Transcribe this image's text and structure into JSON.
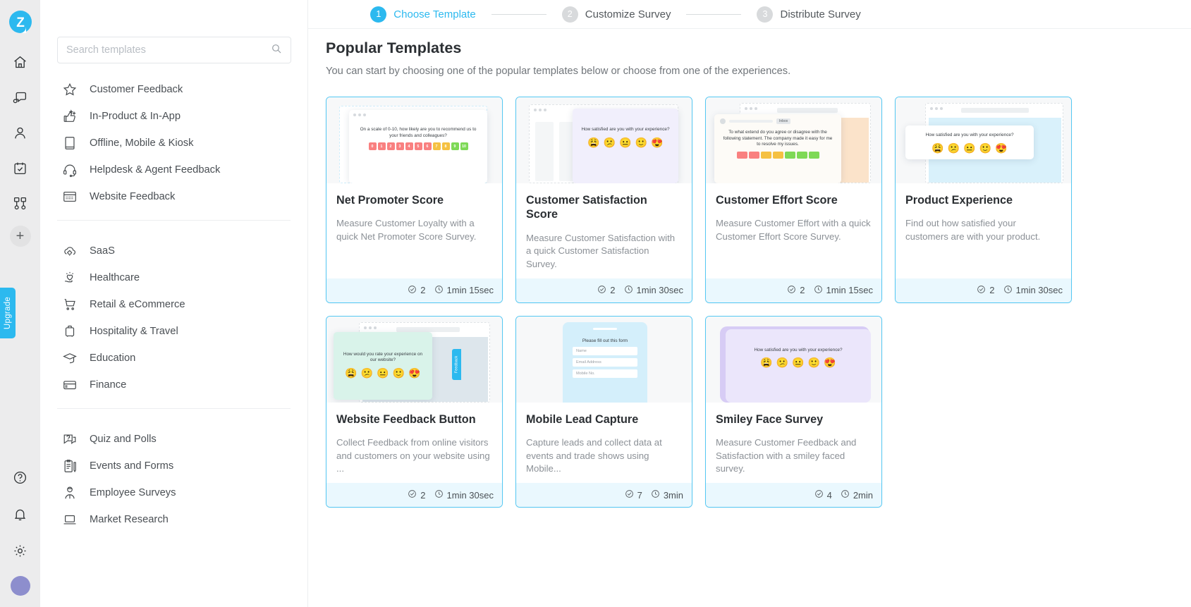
{
  "brand": {
    "logo_text": "Z",
    "accent": "#2cb9ef"
  },
  "rail": {
    "icons": [
      {
        "name": "home-icon"
      },
      {
        "name": "feedback-chat-icon"
      },
      {
        "name": "contacts-user-icon"
      },
      {
        "name": "calendar-check-icon"
      },
      {
        "name": "workflow-icon"
      }
    ],
    "add_label": "+",
    "upgrade_label": "Upgrade",
    "bottom_icons": [
      {
        "name": "help-icon"
      },
      {
        "name": "notifications-bell-icon"
      },
      {
        "name": "settings-gear-icon"
      }
    ]
  },
  "stepper": {
    "steps": [
      {
        "num": "1",
        "label": "Choose Template",
        "active": true
      },
      {
        "num": "2",
        "label": "Customize Survey",
        "active": false
      },
      {
        "num": "3",
        "label": "Distribute Survey",
        "active": false
      }
    ]
  },
  "search": {
    "placeholder": "Search templates",
    "value": ""
  },
  "sidebar": {
    "group1": [
      {
        "label": "Customer Feedback",
        "icon": "star-icon"
      },
      {
        "label": "In-Product & In-App",
        "icon": "thumbs-up-sparkle-icon"
      },
      {
        "label": "Offline, Mobile & Kiosk",
        "icon": "tablet-icon"
      },
      {
        "label": "Helpdesk & Agent Feedback",
        "icon": "headset-icon"
      },
      {
        "label": "Website Feedback",
        "icon": "browser-window-icon"
      }
    ],
    "group2": [
      {
        "label": "SaaS",
        "icon": "cloud-gear-icon"
      },
      {
        "label": "Healthcare",
        "icon": "heart-care-icon"
      },
      {
        "label": "Retail & eCommerce",
        "icon": "shopping-cart-icon"
      },
      {
        "label": "Hospitality & Travel",
        "icon": "suitcase-icon"
      },
      {
        "label": "Education",
        "icon": "graduation-cap-icon"
      },
      {
        "label": "Finance",
        "icon": "wallet-icon"
      }
    ],
    "group3": [
      {
        "label": "Quiz and Polls",
        "icon": "question-chat-icon"
      },
      {
        "label": "Events and Forms",
        "icon": "clipboard-pen-icon"
      },
      {
        "label": "Employee Surveys",
        "icon": "employee-icon"
      },
      {
        "label": "Market Research",
        "icon": "laptop-icon"
      }
    ]
  },
  "main": {
    "title": "Popular Templates",
    "subtitle": "You can start by choosing one of the popular templates below or choose from one of the experiences."
  },
  "templates": [
    {
      "title": "Net Promoter Score",
      "desc": "Measure Customer Loyalty with a quick Net Promoter Score Survey.",
      "questions": "2",
      "duration": "1min 15sec",
      "preview": {
        "kind": "nps",
        "question": "On a scale of 0-10, how likely are you to recommend us to your friends and colleagues?",
        "scale": [
          "0",
          "1",
          "2",
          "3",
          "4",
          "5",
          "6",
          "7",
          "8",
          "9",
          "10"
        ],
        "scale_colors": [
          "#f98080",
          "#f98080",
          "#f98080",
          "#f98080",
          "#f98080",
          "#f98080",
          "#f98080",
          "#f5c142",
          "#f5c142",
          "#7ed957",
          "#7ed957"
        ]
      }
    },
    {
      "title": "Customer Satisfaction Score",
      "desc": "Measure Customer Satisfaction with a quick Customer Satisfaction Survey.",
      "questions": "2",
      "duration": "1min 30sec",
      "preview": {
        "kind": "csat",
        "question": "How satisfied are you with your experience?",
        "emojis": [
          "😩",
          "😕",
          "😐",
          "🙂",
          "😍"
        ],
        "panel_color": "#f1effc"
      }
    },
    {
      "title": "Customer Effort Score",
      "desc": "Measure Customer Effort with a quick Customer Effort Score Survey.",
      "questions": "2",
      "duration": "1min 15sec",
      "preview": {
        "kind": "ces",
        "badge": "Inbox",
        "question": "To what extend do you agree or disagree with the following statement. The company made it easy for me to resolve my issues.",
        "bar_colors": [
          "#f98080",
          "#f98080",
          "#f5c142",
          "#f5c142",
          "#7ed957",
          "#7ed957",
          "#7ed957"
        ],
        "panel_color": "#fbe3ca"
      }
    },
    {
      "title": "Product Experience",
      "desc": "Find out how satisfied your customers are with your product.",
      "questions": "2",
      "duration": "1min 30sec",
      "preview": {
        "kind": "pex",
        "question": "How satisfied are you with your experience?",
        "emojis": [
          "😩",
          "😕",
          "😐",
          "🙂",
          "😍"
        ],
        "panel_color": "#d9f1fb"
      }
    },
    {
      "title": "Website Feedback Button",
      "desc": "Collect Feedback from online visitors and customers on your website using ...",
      "questions": "2",
      "duration": "1min 30sec",
      "preview": {
        "kind": "wfb",
        "question": "How would you rate your experience on our website?",
        "emojis": [
          "😩",
          "😕",
          "😐",
          "🙂",
          "😍"
        ],
        "panel_color": "#d9f3ea",
        "tab_label": "Feedback"
      }
    },
    {
      "title": "Mobile Lead Capture",
      "desc": "Capture leads and collect data at events and trade shows using Mobile...",
      "questions": "7",
      "duration": "3min",
      "preview": {
        "kind": "mlc",
        "question": "Please fill out this form",
        "fields": [
          "Name",
          "Email Address",
          "Mobile No."
        ],
        "panel_color": "#d4effb"
      }
    },
    {
      "title": "Smiley Face Survey",
      "desc": "Measure Customer Feedback and Satisfaction with a smiley faced survey.",
      "questions": "4",
      "duration": "2min",
      "preview": {
        "kind": "sfs",
        "question": "How satisfied are you with your experience?",
        "emojis": [
          "😩",
          "😕",
          "😐",
          "🙂",
          "😍"
        ],
        "panel_color": "#ebe6fb"
      }
    }
  ],
  "icons": {
    "questions": "check-circle-icon",
    "duration": "clock-icon"
  }
}
